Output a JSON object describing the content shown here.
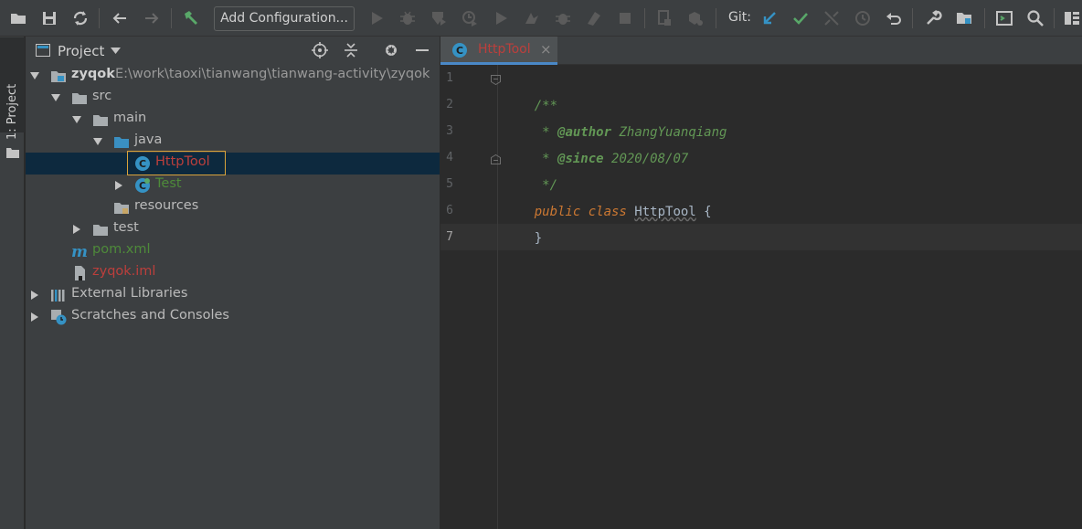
{
  "toolbar": {
    "add_configuration": "Add Configuration...",
    "git_label": "Git:",
    "icons": [
      "open-icon",
      "save-icon",
      "sync-icon",
      "back-icon",
      "forward-icon",
      "build-hammer-icon",
      "run-icon",
      "debug-icon",
      "coverage-icon",
      "profile-icon",
      "run-alt-icon",
      "attach-icon",
      "debug-alt-icon",
      "build-artifact-icon",
      "stop-icon",
      "device-icon",
      "deploy-icon",
      "git-update-icon",
      "git-commit-icon",
      "git-merge-icon",
      "git-history-icon",
      "git-rollback-icon",
      "settings-wrench-icon",
      "project-structure-icon",
      "terminal-icon",
      "search-icon",
      "layout-icon"
    ]
  },
  "side_strip": {
    "tab_label": "1: Project"
  },
  "project_panel": {
    "title": "Project",
    "tree": [
      {
        "label": "zyqok",
        "path": "E:\\work\\taoxi\\tianwang\\tianwang-activity\\zyqok",
        "color": "#d0d0d0",
        "bold": true,
        "icon": "module-folder-icon",
        "arrow": "down"
      },
      {
        "label": "src",
        "color": "#bbbbbb",
        "icon": "folder-icon",
        "arrow": "down"
      },
      {
        "label": "main",
        "color": "#bbbbbb",
        "icon": "folder-icon",
        "arrow": "down"
      },
      {
        "label": "java",
        "color": "#bbbbbb",
        "icon": "source-folder-icon",
        "arrow": "down"
      },
      {
        "label": "HttpTool",
        "color": "#bc3f3c",
        "icon": "java-class-icon",
        "arrow": "none",
        "selected": true
      },
      {
        "label": "Test",
        "color": "#4e8a3a",
        "icon": "java-class-icon",
        "arrow": "right"
      },
      {
        "label": "resources",
        "color": "#bbbbbb",
        "icon": "resources-folder-icon",
        "arrow": "none"
      },
      {
        "label": "test",
        "color": "#bbbbbb",
        "icon": "folder-icon",
        "arrow": "right"
      },
      {
        "label": "pom.xml",
        "color": "#4e8a3a",
        "icon": "maven-icon",
        "arrow": "none"
      },
      {
        "label": "zyqok.iml",
        "color": "#bc3f3c",
        "icon": "iml-file-icon",
        "arrow": "none"
      },
      {
        "label": "External Libraries",
        "color": "#bbbbbb",
        "icon": "libraries-icon",
        "arrow": "right"
      },
      {
        "label": "Scratches and Consoles",
        "color": "#bbbbbb",
        "icon": "scratches-icon",
        "arrow": "right"
      }
    ]
  },
  "editor": {
    "tab_label": "HttpTool",
    "close_glyph": "×",
    "line_numbers": [
      "1",
      "2",
      "3",
      "4",
      "5",
      "6",
      "7"
    ],
    "code": {
      "l1": "/**",
      "l2_prefix": " * ",
      "l2_tag": "@author",
      "l2_value": " ZhangYuanqiang",
      "l3_prefix": " * ",
      "l3_tag": "@since",
      "l3_value": " 2020/08/07",
      "l4": " */",
      "l5_kw": "public class ",
      "l5_class": "HttpTool",
      "l5_rest": " {",
      "l6": "}"
    }
  },
  "colors": {
    "accent": "#4a88c7",
    "selection": "#0d293e",
    "error_red": "#bc3f3c",
    "vcs_green": "#4e8a3a"
  }
}
